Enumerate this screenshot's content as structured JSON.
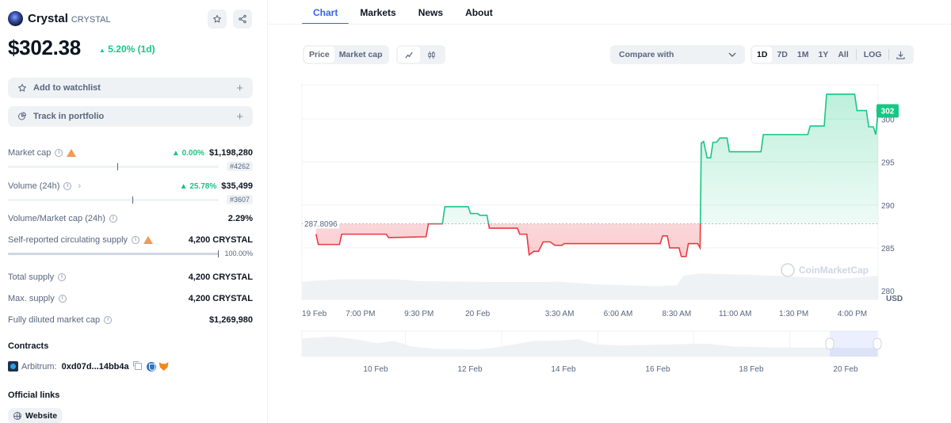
{
  "coin": {
    "name": "Crystal",
    "symbol": "CRYSTAL",
    "price": "$302.38",
    "change_1d": "5.20% (1d)",
    "change_direction": "up"
  },
  "header_icons": {
    "favorite": "star-icon",
    "share": "share-icon"
  },
  "actions": [
    {
      "label": "Add to watchlist",
      "icon": "star-icon"
    },
    {
      "label": "Track in portfolio",
      "icon": "pie-chart-icon"
    }
  ],
  "stats": {
    "market_cap": {
      "label": "Market cap",
      "change": "0.00%",
      "value": "$1,198,280",
      "rank": "#4262",
      "bar_fraction": 0.52
    },
    "volume": {
      "label": "Volume (24h)",
      "change": "25.78%",
      "value": "$35,499",
      "rank": "#3607",
      "bar_fraction": 0.59
    },
    "vol_mcap": {
      "label": "Volume/Market cap (24h)",
      "value": "2.29%"
    },
    "circ_supply": {
      "label": "Self-reported circulating supply",
      "value": "4,200 CRYSTAL",
      "percent": "100.00%",
      "fraction": 1.0
    },
    "total_supply": {
      "label": "Total supply",
      "value": "4,200 CRYSTAL"
    },
    "max_supply": {
      "label": "Max. supply",
      "value": "4,200 CRYSTAL"
    },
    "fdv": {
      "label": "Fully diluted market cap",
      "value": "$1,269,980"
    }
  },
  "contracts": {
    "title": "Contracts",
    "chain": "Arbitrum:",
    "address": "0xd07d...14bb4a"
  },
  "links": {
    "title": "Official links",
    "website": "Website"
  },
  "tabs": [
    {
      "label": "Chart",
      "active": true
    },
    {
      "label": "Markets",
      "active": false
    },
    {
      "label": "News",
      "active": false
    },
    {
      "label": "About",
      "active": false
    }
  ],
  "chart_controls": {
    "type_options": [
      {
        "label": "Price",
        "on": true
      },
      {
        "label": "Market cap",
        "on": false
      }
    ],
    "style_options": [
      {
        "icon": "line-chart-icon",
        "on": true
      },
      {
        "icon": "candlestick-icon",
        "on": false
      }
    ],
    "compare_label": "Compare with",
    "ranges": [
      {
        "label": "1D",
        "on": true
      },
      {
        "label": "7D",
        "on": false
      },
      {
        "label": "1M",
        "on": false
      },
      {
        "label": "1Y",
        "on": false
      },
      {
        "label": "All",
        "on": false
      }
    ],
    "log_label": "LOG",
    "download_icon": "download-icon"
  },
  "chart_data": {
    "type": "line",
    "title": "",
    "xlabel": "",
    "ylabel": "USD",
    "currency_label": "USD",
    "watermark": "CoinMarketCap",
    "baseline": 287.8096,
    "baseline_label": "287.8096",
    "current_label": "302",
    "ylim": [
      279,
      304
    ],
    "yticks": [
      280,
      285,
      290,
      295,
      300
    ],
    "xlim": [
      0,
      24.6
    ],
    "xticks": [
      {
        "t": 0,
        "label": "19 Feb"
      },
      {
        "t": 2.5,
        "label": "7:00 PM"
      },
      {
        "t": 5,
        "label": "9:30 PM"
      },
      {
        "t": 7.5,
        "label": "20 Feb"
      },
      {
        "t": 11,
        "label": "3:30 AM"
      },
      {
        "t": 13.5,
        "label": "6:00 AM"
      },
      {
        "t": 16,
        "label": "8:30 AM"
      },
      {
        "t": 18.5,
        "label": "11:00 AM"
      },
      {
        "t": 21,
        "label": "1:30 PM"
      },
      {
        "t": 23.5,
        "label": "4:00 PM"
      }
    ],
    "grid": true,
    "series": [
      {
        "name": "Price",
        "points": [
          [
            0.6,
            286.6
          ],
          [
            0.7,
            285.4
          ],
          [
            1.6,
            285.4
          ],
          [
            1.7,
            286.6
          ],
          [
            3.6,
            286.6
          ],
          [
            3.7,
            286.2
          ],
          [
            5.3,
            286.3
          ],
          [
            5.4,
            287.8
          ],
          [
            6.0,
            287.8
          ],
          [
            6.1,
            289.8
          ],
          [
            7.1,
            289.8
          ],
          [
            7.2,
            289.0
          ],
          [
            7.5,
            289.0
          ],
          [
            7.6,
            288.8
          ],
          [
            7.9,
            288.8
          ],
          [
            8.0,
            287.3
          ],
          [
            8.5,
            287.3
          ],
          [
            9.2,
            287.3
          ],
          [
            9.3,
            286.6
          ],
          [
            9.6,
            286.6
          ],
          [
            9.7,
            284.2
          ],
          [
            9.9,
            284.6
          ],
          [
            10.1,
            284.6
          ],
          [
            10.3,
            285.7
          ],
          [
            10.6,
            285.7
          ],
          [
            10.8,
            285.3
          ],
          [
            11.1,
            285.3
          ],
          [
            11.2,
            285.5
          ],
          [
            15.3,
            285.5
          ],
          [
            15.4,
            286.4
          ],
          [
            15.6,
            286.4
          ],
          [
            15.7,
            285.0
          ],
          [
            16.1,
            285.0
          ],
          [
            16.2,
            284.0
          ],
          [
            16.4,
            284.0
          ],
          [
            16.5,
            285.5
          ],
          [
            16.9,
            285.5
          ],
          [
            17.0,
            285.0
          ],
          [
            17.05,
            297.2
          ],
          [
            17.15,
            297.4
          ],
          [
            17.3,
            295.5
          ],
          [
            17.45,
            295.5
          ],
          [
            17.55,
            297.3
          ],
          [
            17.7,
            297.3
          ],
          [
            17.85,
            297.8
          ],
          [
            18.15,
            297.8
          ],
          [
            18.25,
            296.2
          ],
          [
            19.6,
            296.2
          ],
          [
            19.7,
            298.2
          ],
          [
            21.6,
            298.2
          ],
          [
            21.7,
            299.2
          ],
          [
            22.3,
            299.2
          ],
          [
            22.4,
            302.9
          ],
          [
            23.6,
            302.9
          ],
          [
            23.7,
            301.0
          ],
          [
            24.1,
            301.0
          ],
          [
            24.2,
            299.1
          ],
          [
            24.4,
            299.1
          ],
          [
            24.5,
            298.2
          ],
          [
            24.6,
            301.0
          ]
        ]
      }
    ],
    "volume_note": "light grey volume area beneath price",
    "navigator": {
      "xticks": [
        "10 Feb",
        "12 Feb",
        "14 Feb",
        "16 Feb",
        "18 Feb",
        "20 Feb"
      ],
      "selected_range": [
        "20 Feb",
        "21 Feb"
      ]
    }
  }
}
